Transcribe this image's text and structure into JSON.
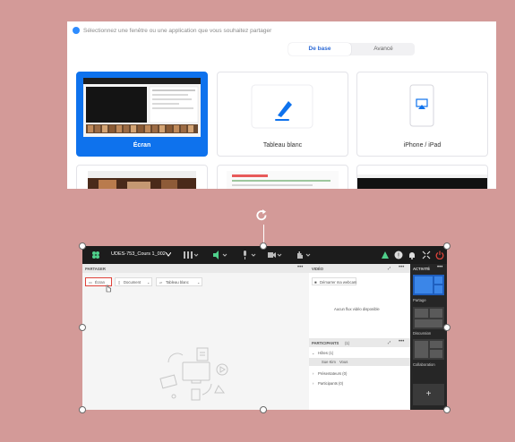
{
  "share_dialog": {
    "title": "Sélectionnez une fenêtre ou une application que vous souhaitez partager",
    "tabs": [
      {
        "label": "De base",
        "selected": true
      },
      {
        "label": "Avancé",
        "selected": false
      }
    ],
    "tiles": [
      {
        "label": "Écran",
        "selected": true
      },
      {
        "label": "Tableau blanc",
        "selected": false
      },
      {
        "label": "iPhone / iPad",
        "selected": false
      }
    ]
  },
  "zoom_window": {
    "meeting_name": "UDES-753_Cours 1_002",
    "share_panel_title": "PARTAGER",
    "share_buttons": {
      "screen": "Écran",
      "document": "Document",
      "whiteboard": "Tableau blanc"
    },
    "video_panel_title": "VIDÉO",
    "webcam_button": "Démarrer ma webcam",
    "no_video_text": "Aucun flux vidéo disponible",
    "participants_title": "PARTICIPANTS",
    "participants_count": "(1)",
    "host_group": "Hôtes (1)",
    "host_name": "Sue Kim",
    "host_role": "Vous",
    "presenters_group": "Présentateurs (0)",
    "attendees_group": "Participants (0)",
    "activity_title": "ACTIVITÉ",
    "activities": [
      "Partage",
      "Discussion",
      "Collaboration"
    ],
    "add_symbol": "+"
  },
  "colors": {
    "background": "#d39a98",
    "accent": "#0e72ed",
    "toolbar": "#1c1c1c"
  }
}
